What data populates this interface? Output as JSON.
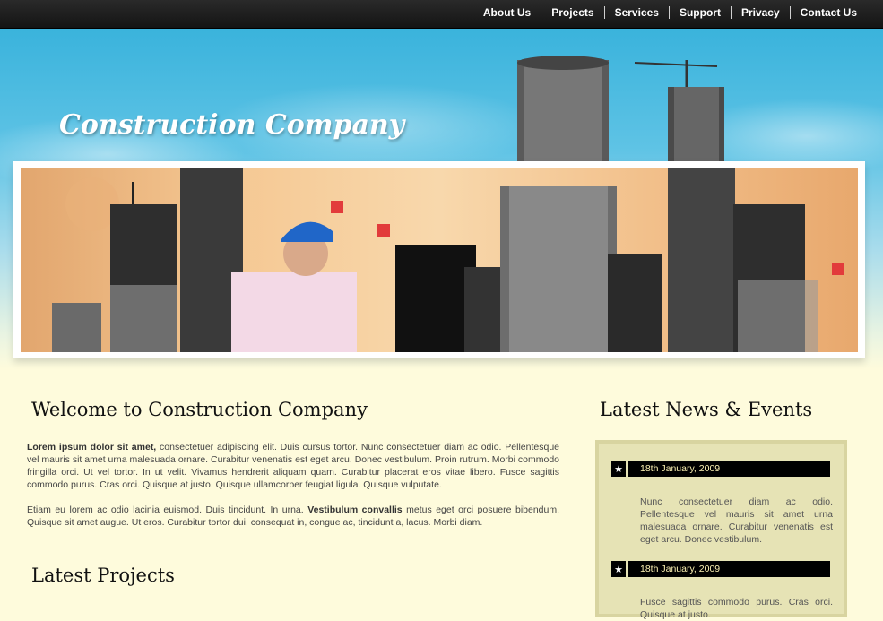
{
  "nav": {
    "items": [
      "About Us",
      "Projects",
      "Services",
      "Support",
      "Privacy",
      "Contact Us"
    ]
  },
  "header": {
    "logo": "Construction Company"
  },
  "welcome": {
    "title": "Welcome to Construction Company",
    "p1_bold": "Lorem ipsum dolor sit amet,",
    "p1_text": " consectetuer adipiscing elit. Duis cursus tortor. Nunc consectetuer diam ac odio. Pellentesque vel mauris sit amet urna malesuada ornare. Curabitur venenatis est eget arcu. Donec vestibulum. Proin rutrum. Morbi commodo fringilla orci. Ut vel tortor. In ut velit. Vivamus hendrerit aliquam quam. Curabitur placerat eros vitae libero. Fusce sagittis commodo purus. Cras orci. Quisque at justo. Quisque ullamcorper feugiat ligula. Quisque vulputate.",
    "p2_text_a": "Etiam eu lorem ac odio lacinia euismod. Duis tincidunt. In urna. ",
    "p2_bold": "Vestibulum convallis",
    "p2_text_b": " metus eget orci posuere bibendum. Quisque sit amet augue. Ut eros. Curabitur tortor dui, consequat in, congue ac, tincidunt a, lacus. Morbi diam."
  },
  "projects": {
    "title": "Latest Projects"
  },
  "news": {
    "title": "Latest News & Events",
    "items": [
      {
        "date": "18th January, 2009",
        "text": "Nunc consectetuer diam ac odio. Pellentesque vel mauris sit amet urna malesuada ornare. Curabitur venenatis est eget arcu. Donec vestibulum."
      },
      {
        "date": "18th January, 2009",
        "text": "Fusce sagittis commodo purus. Cras orci. Quisque at justo."
      }
    ]
  },
  "icons": {
    "news_bullet": "star-icon"
  },
  "colors": {
    "background": "#fefbdc",
    "news_box": "#e6e3b5",
    "date_text": "#fdf2b3"
  }
}
